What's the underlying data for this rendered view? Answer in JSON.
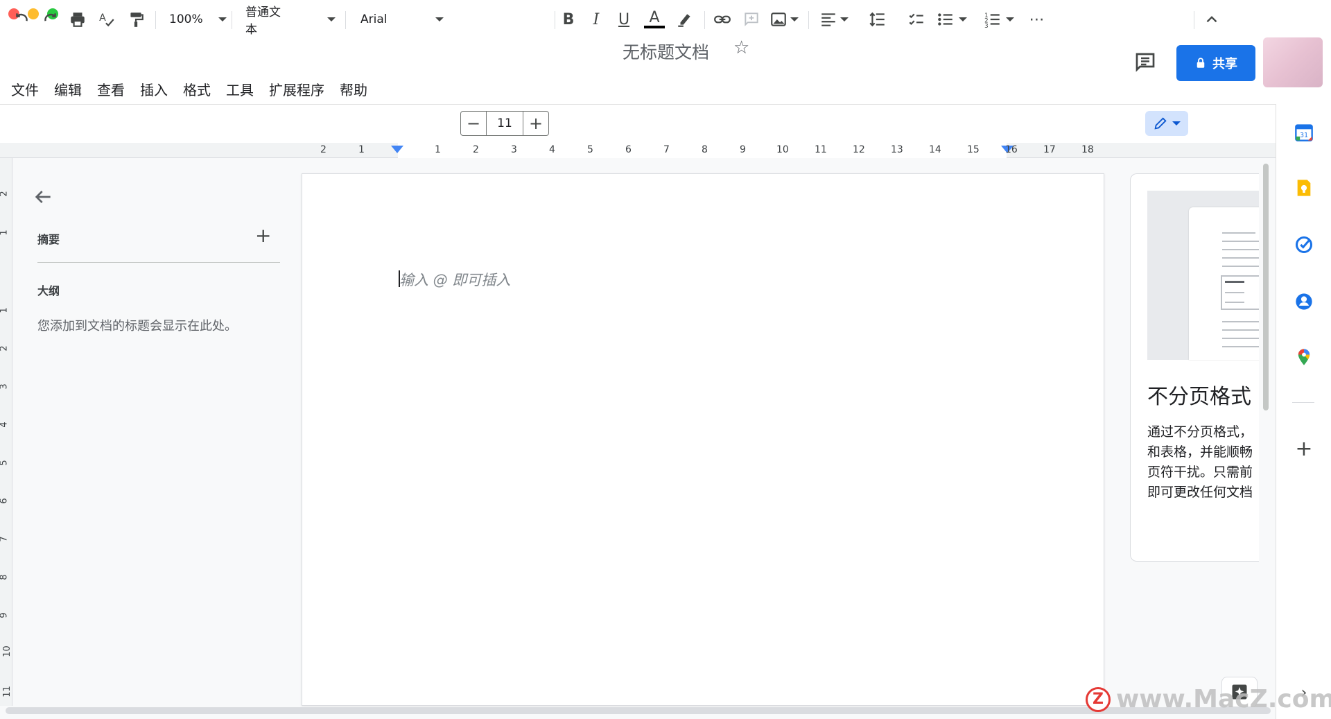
{
  "window": {
    "title": "无标题文档"
  },
  "menu": [
    "文件",
    "编辑",
    "查看",
    "插入",
    "格式",
    "工具",
    "扩展程序",
    "帮助"
  ],
  "header": {
    "share_label": "共享"
  },
  "toolbar": {
    "zoom": "100%",
    "style": "普通文本",
    "font": "Arial",
    "font_size": "11"
  },
  "ruler": {
    "horizontal": [
      "2",
      "1",
      "1",
      "2",
      "3",
      "4",
      "5",
      "6",
      "7",
      "8",
      "9",
      "10",
      "11",
      "12",
      "13",
      "14",
      "15",
      "16",
      "17",
      "18"
    ],
    "vertical": [
      "2",
      "1",
      "1",
      "2",
      "3",
      "4",
      "5",
      "6",
      "7",
      "8",
      "9",
      "10",
      "11"
    ]
  },
  "outline": {
    "summary_label": "摘要",
    "outline_label": "大纲",
    "hint": "您添加到文档的标题会显示在此处。"
  },
  "document": {
    "placeholder": "输入 @ 即可插入"
  },
  "promo": {
    "title": "不分页格式",
    "lines": [
      "通过不分页格式，",
      "和表格，并能顺畅",
      "页符干扰。只需前",
      "即可更改任何文档"
    ]
  },
  "watermark": {
    "logo": "Z",
    "text": "www.MacZ.com"
  },
  "side_icons": [
    "calendar-icon",
    "keep-icon",
    "tasks-icon",
    "contacts-icon",
    "maps-icon"
  ],
  "colors": {
    "accent": "#1a73e8",
    "edit_mode_bg": "#d3e3fd"
  }
}
